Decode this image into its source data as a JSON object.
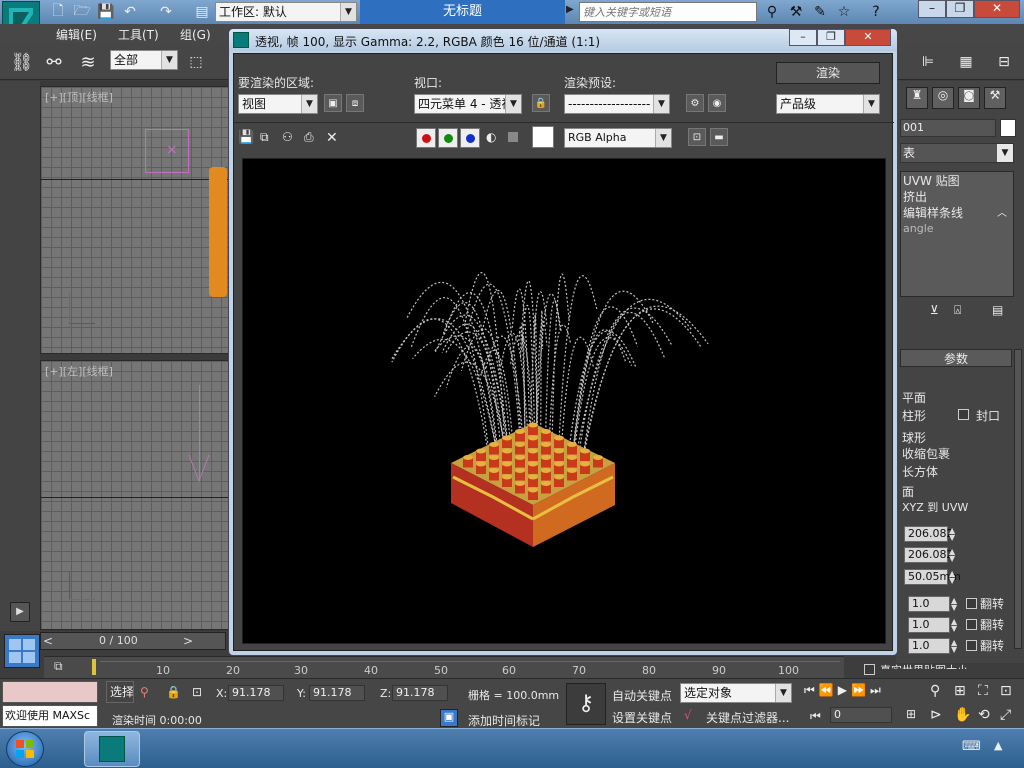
{
  "titlebar": {
    "workspace_label": "工作区: 默认",
    "doc_title": "无标题",
    "search_placeholder": "键入关键字或短语"
  },
  "menubar": {
    "items": [
      "编辑(E)",
      "工具(T)",
      "组(G)"
    ]
  },
  "toolbar": {
    "selection_filter": "全部"
  },
  "viewports": {
    "top_label": "[+][顶][线框]",
    "left_label": "[+][左][线框]"
  },
  "render_dialog": {
    "title": "透视, 帧 100, 显示 Gamma: 2.2, RGBA 颜色 16 位/通道 (1:1)",
    "area_label": "要渲染的区域:",
    "area_value": "视图",
    "viewport_label": "视口:",
    "viewport_value": "四元菜单 4 - 透视",
    "preset_label": "渲染预设:",
    "preset_value": "-------------------",
    "render_button": "渲染",
    "quality_value": "产品级",
    "channel_value": "RGB Alpha"
  },
  "command_panel": {
    "object_name": "001",
    "modifier_list": "表",
    "stack_items": [
      "UVW 贴图",
      "挤出",
      "编辑样条线",
      "angle"
    ],
    "rollout_title": "参数",
    "mapping_options": [
      "平面",
      "柱形",
      "球形",
      "收缩包裹",
      "长方体",
      "面",
      "XYZ 到 UVW"
    ],
    "cap_label": "封口",
    "length": "206.082",
    "width": "206.082",
    "height": "50.05mm",
    "tile_u": "1.0",
    "tile_v": "1.0",
    "tile_w": "1.0",
    "flip_label": "翻转",
    "real_world_label": "真实世界贴图大小"
  },
  "timeline": {
    "frame_counter": "0 / 100",
    "ticks": [
      "10",
      "20",
      "30",
      "40",
      "50",
      "60",
      "70",
      "80",
      "90",
      "100"
    ]
  },
  "status": {
    "welcome": "欢迎使用 MAXSc",
    "select_label": "选择",
    "x_label": "X:",
    "x_value": "91.178",
    "y_label": "Y:",
    "y_value": "91.178",
    "z_label": "Z:",
    "z_value": "91.178",
    "grid_label": "栅格 = 100.0mm",
    "render_time": "渲染时间  0:00:00",
    "add_time_tag": "添加时间标记",
    "auto_key": "自动关键点",
    "set_key": "设置关键点",
    "key_mode_value": "选定对象",
    "key_filter": "关键点过滤器...",
    "current_frame": "0"
  },
  "colors": {
    "taskbar": "#2c5f8e",
    "render_bg": "#000000",
    "accent_red": "#d01010",
    "accent_green": "#108a10",
    "accent_blue": "#1030c8"
  }
}
